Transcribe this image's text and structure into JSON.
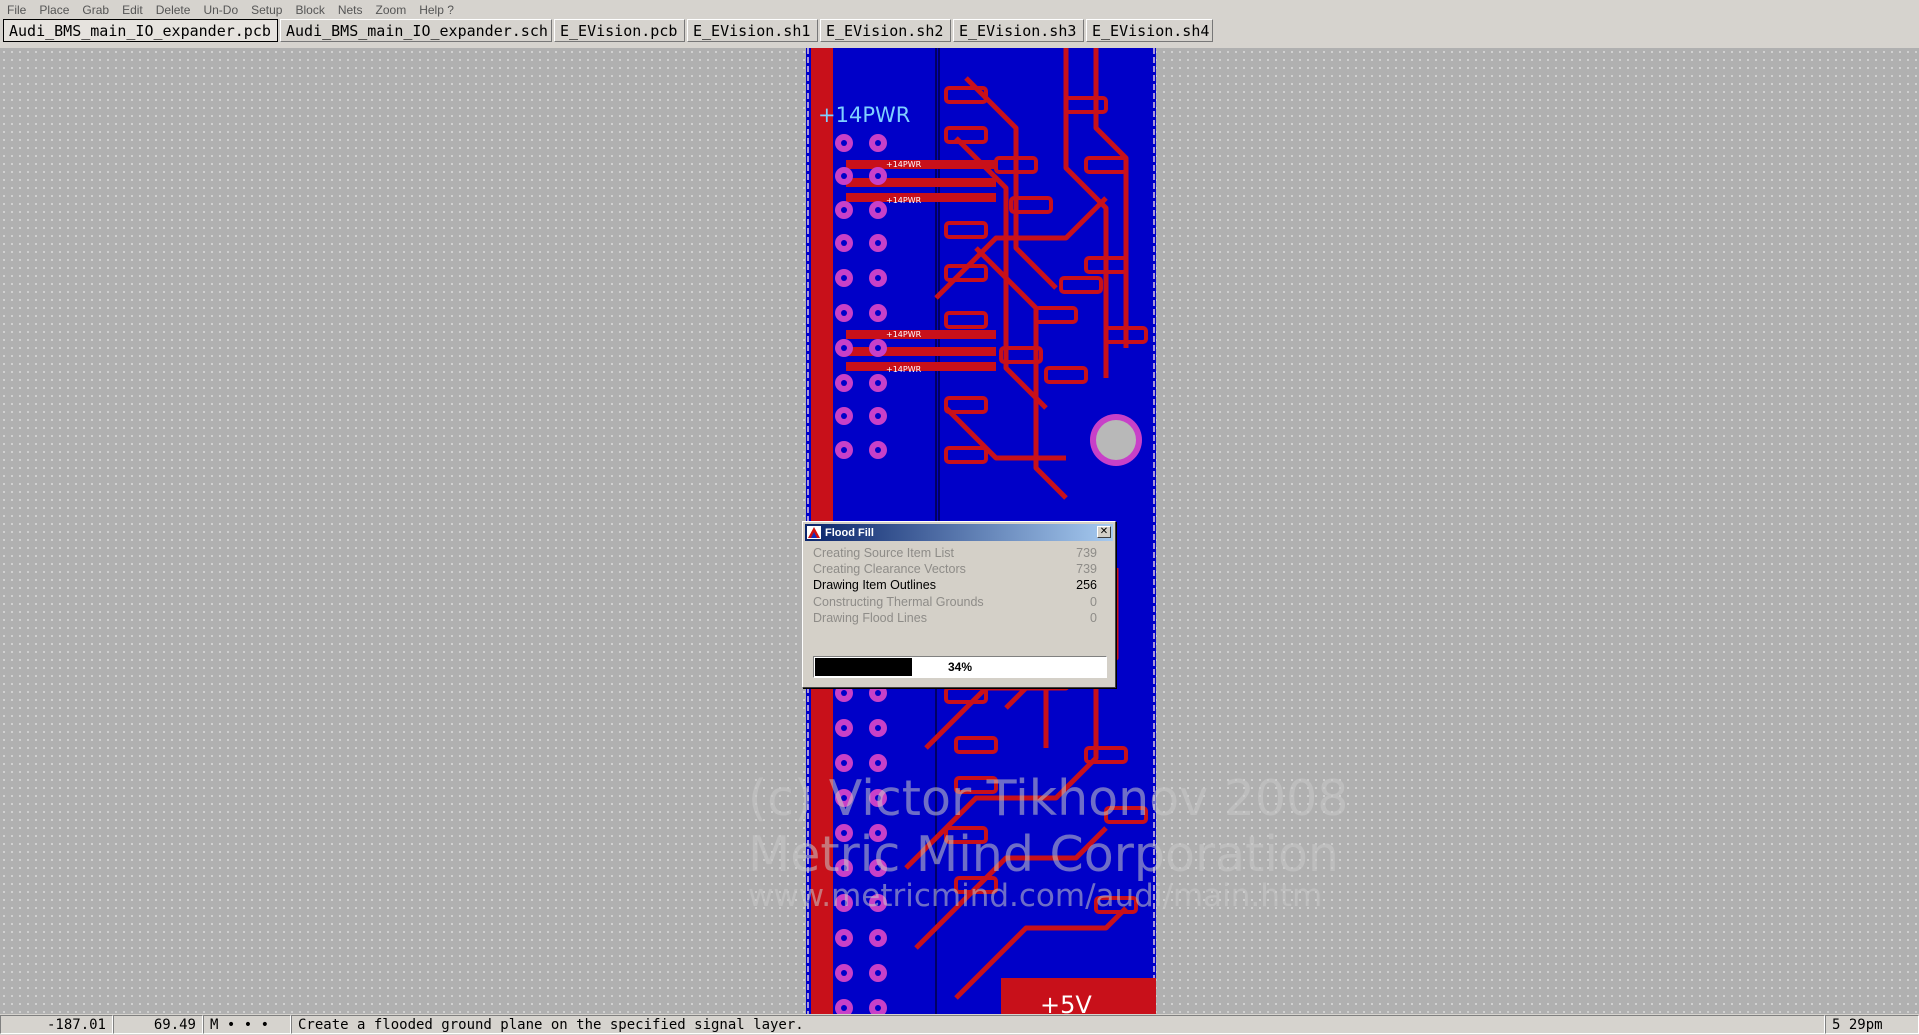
{
  "menu": [
    "File",
    "Place",
    "Grab",
    "Edit",
    "Delete",
    "Un-Do",
    "Setup",
    "Block",
    "Nets",
    "Zoom",
    "Help ?"
  ],
  "tabs": [
    {
      "label": "Audi_BMS_main_IO_expander.pcb",
      "active": true
    },
    {
      "label": "Audi_BMS_main_IO_expander.sch",
      "active": false
    },
    {
      "label": "E_EVision.pcb",
      "active": false
    },
    {
      "label": "E_EVision.sh1",
      "active": false
    },
    {
      "label": "E_EVision.sh2",
      "active": false
    },
    {
      "label": "E_EVision.sh3",
      "active": false
    },
    {
      "label": "E_EVision.sh4",
      "active": false
    }
  ],
  "pcb": {
    "labels": {
      "big_net": "+14PWR",
      "small_net": "+14PWR",
      "bottom_net": "+5V"
    },
    "colors": {
      "board": "#0000c8",
      "copper": "#c8101a",
      "pad": "#c840c8",
      "outline": "#e0c8e0"
    }
  },
  "watermark": {
    "line1": "(c) Victor Tikhonov 2008",
    "line2": "Metric Mind Corporation",
    "line3": "www.metricmind.com/audi/main.htm"
  },
  "dialog": {
    "title": "Flood Fill",
    "close_glyph": "✕",
    "steps": [
      {
        "label": "Creating Source Item List",
        "count": "739",
        "state": "done"
      },
      {
        "label": "Creating Clearance Vectors",
        "count": "739",
        "state": "done"
      },
      {
        "label": "Drawing Item Outlines",
        "count": "256",
        "state": "current"
      },
      {
        "label": "Constructing Thermal Grounds",
        "count": "0",
        "state": "pending"
      },
      {
        "label": "Drawing Flood Lines",
        "count": "0",
        "state": "pending"
      }
    ],
    "progress_percent": 34,
    "progress_text": "34%"
  },
  "status": {
    "x": "-187.01",
    "y": "69.49",
    "mode": "M • • •",
    "message": "Create a flooded ground plane on the specified signal layer.",
    "time": "5 29pm"
  }
}
